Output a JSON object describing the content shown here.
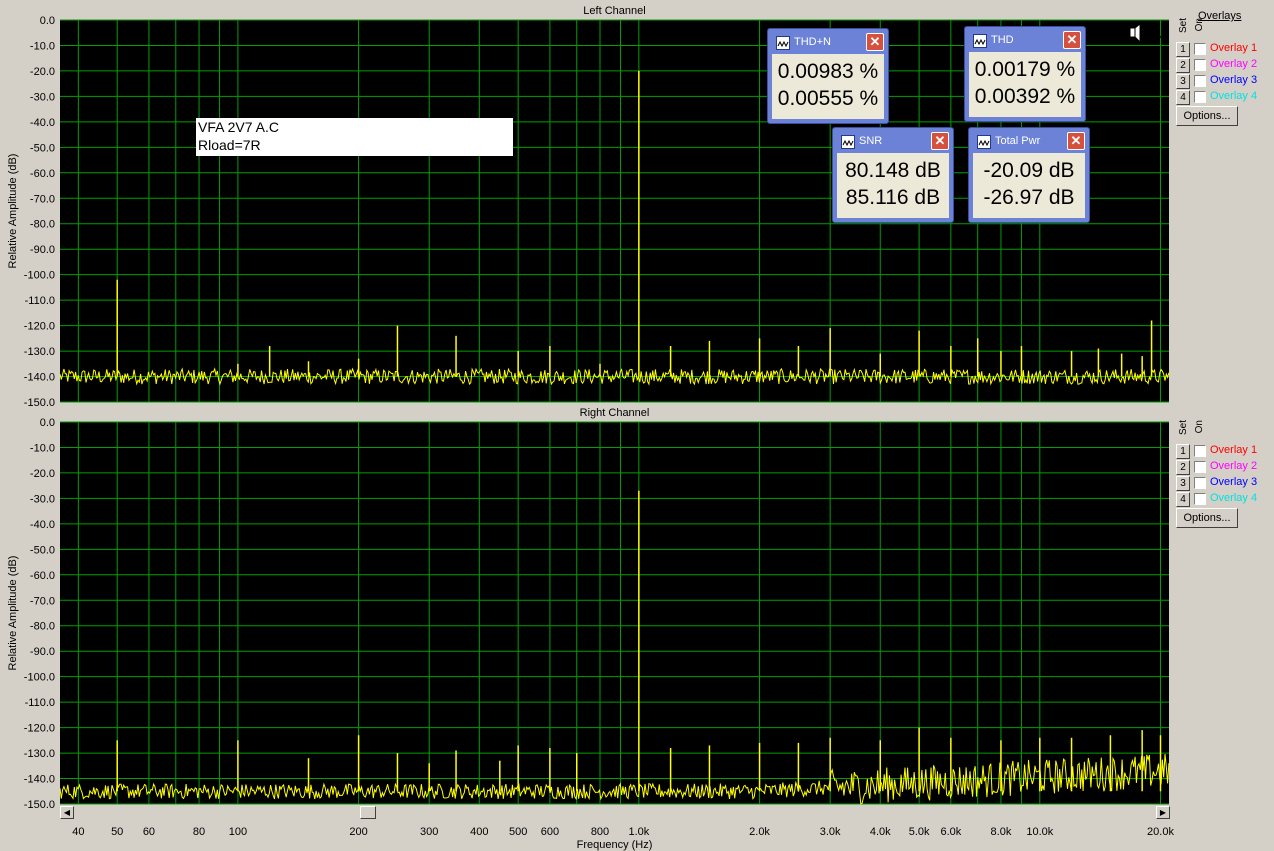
{
  "chart_data": [
    {
      "type": "line",
      "title": "Left Channel",
      "xlabel": "Frequency (Hz)",
      "ylabel": "Relative Amplitude (dB)",
      "xscale": "log",
      "xlim": [
        36,
        21000
      ],
      "ylim": [
        -150,
        0
      ],
      "grid": true,
      "line_color": "#ffff00",
      "background": "#000000",
      "grid_color": "#00a000",
      "noise_floor": -140,
      "yticks": [
        "0.0",
        "-10.0",
        "-20.0",
        "-30.0",
        "-40.0",
        "-50.0",
        "-60.0",
        "-70.0",
        "-80.0",
        "-90.0",
        "-100.0",
        "-110.0",
        "-120.0",
        "-130.0",
        "-140.0",
        "-150.0"
      ],
      "peaks": [
        {
          "x": 50,
          "y": -102
        },
        {
          "x": 100,
          "y": -135
        },
        {
          "x": 120,
          "y": -128
        },
        {
          "x": 150,
          "y": -134
        },
        {
          "x": 200,
          "y": -133
        },
        {
          "x": 250,
          "y": -120
        },
        {
          "x": 350,
          "y": -124
        },
        {
          "x": 500,
          "y": -130
        },
        {
          "x": 600,
          "y": -128
        },
        {
          "x": 800,
          "y": -135
        },
        {
          "x": 1000,
          "y": -20
        },
        {
          "x": 1200,
          "y": -128
        },
        {
          "x": 1500,
          "y": -126
        },
        {
          "x": 2000,
          "y": -125
        },
        {
          "x": 2500,
          "y": -128
        },
        {
          "x": 3000,
          "y": -121
        },
        {
          "x": 4000,
          "y": -131
        },
        {
          "x": 5000,
          "y": -122
        },
        {
          "x": 6000,
          "y": -128
        },
        {
          "x": 7000,
          "y": -125
        },
        {
          "x": 8000,
          "y": -130
        },
        {
          "x": 9000,
          "y": -128
        },
        {
          "x": 12000,
          "y": -130
        },
        {
          "x": 14000,
          "y": -129
        },
        {
          "x": 16000,
          "y": -131
        },
        {
          "x": 18000,
          "y": -132
        },
        {
          "x": 19000,
          "y": -118
        }
      ],
      "annotation": [
        "VFA 2V7 A.C",
        "Rload=7R"
      ]
    },
    {
      "type": "line",
      "title": "Right Channel",
      "xlabel": "Frequency (Hz)",
      "ylabel": "Relative Amplitude (dB)",
      "xscale": "log",
      "xlim": [
        36,
        21000
      ],
      "ylim": [
        -150,
        0
      ],
      "grid": true,
      "line_color": "#ffff00",
      "background": "#000000",
      "grid_color": "#00a000",
      "noise_floor": -145,
      "xticks": [
        {
          "value": 40,
          "label": "40"
        },
        {
          "value": 50,
          "label": "50"
        },
        {
          "value": 60,
          "label": "60"
        },
        {
          "value": 80,
          "label": "80"
        },
        {
          "value": 100,
          "label": "100"
        },
        {
          "value": 200,
          "label": "200"
        },
        {
          "value": 300,
          "label": "300"
        },
        {
          "value": 400,
          "label": "400"
        },
        {
          "value": 500,
          "label": "500"
        },
        {
          "value": 600,
          "label": "600"
        },
        {
          "value": 800,
          "label": "800"
        },
        {
          "value": 1000,
          "label": "1.0k"
        },
        {
          "value": 2000,
          "label": "2.0k"
        },
        {
          "value": 3000,
          "label": "3.0k"
        },
        {
          "value": 4000,
          "label": "4.0k"
        },
        {
          "value": 5000,
          "label": "5.0k"
        },
        {
          "value": 6000,
          "label": "6.0k"
        },
        {
          "value": 8000,
          "label": "8.0k"
        },
        {
          "value": 10000,
          "label": "10.0k"
        },
        {
          "value": 20000,
          "label": "20.0k"
        }
      ],
      "yticks": [
        "0.0",
        "-10.0",
        "-20.0",
        "-30.0",
        "-40.0",
        "-50.0",
        "-60.0",
        "-70.0",
        "-80.0",
        "-90.0",
        "-100.0",
        "-110.0",
        "-120.0",
        "-130.0",
        "-140.0",
        "-150.0"
      ],
      "peaks": [
        {
          "x": 50,
          "y": -125
        },
        {
          "x": 100,
          "y": -125
        },
        {
          "x": 150,
          "y": -132
        },
        {
          "x": 200,
          "y": -123
        },
        {
          "x": 250,
          "y": -130
        },
        {
          "x": 300,
          "y": -134
        },
        {
          "x": 350,
          "y": -129
        },
        {
          "x": 450,
          "y": -133
        },
        {
          "x": 500,
          "y": -127
        },
        {
          "x": 600,
          "y": -128
        },
        {
          "x": 700,
          "y": -130
        },
        {
          "x": 1000,
          "y": -27
        },
        {
          "x": 1200,
          "y": -128
        },
        {
          "x": 1500,
          "y": -127
        },
        {
          "x": 2000,
          "y": -126
        },
        {
          "x": 2500,
          "y": -126
        },
        {
          "x": 3000,
          "y": -124
        },
        {
          "x": 4000,
          "y": -125
        },
        {
          "x": 5000,
          "y": -120
        },
        {
          "x": 6000,
          "y": -124
        },
        {
          "x": 8000,
          "y": -125
        },
        {
          "x": 10000,
          "y": -124
        },
        {
          "x": 12000,
          "y": -124
        },
        {
          "x": 15000,
          "y": -123
        },
        {
          "x": 18000,
          "y": -121
        },
        {
          "x": 20000,
          "y": -123
        }
      ]
    }
  ],
  "overlays": {
    "title": "Overlays",
    "set_label": "Set",
    "on_label": "On",
    "items": [
      {
        "num": "1",
        "label": "Overlay 1",
        "color": "#ff0000"
      },
      {
        "num": "2",
        "label": "Overlay 2",
        "color": "#ff00ff"
      },
      {
        "num": "3",
        "label": "Overlay 3",
        "color": "#0000ff"
      },
      {
        "num": "4",
        "label": "Overlay 4",
        "color": "#00e0e0"
      }
    ],
    "options_label": "Options..."
  },
  "meters": {
    "thdn": {
      "name": "THD+N",
      "v1": "0.00983 %",
      "v2": "0.00555 %"
    },
    "thd": {
      "name": "THD",
      "v1": "0.00179 %",
      "v2": "0.00392 %"
    },
    "snr": {
      "name": "SNR",
      "v1": "80.148 dB",
      "v2": "85.116 dB"
    },
    "pwr": {
      "name": "Total Pwr",
      "v1": "-20.09 dB",
      "v2": "-26.97 dB"
    }
  },
  "icons": {
    "close": "close-icon",
    "meter": "meter-icon",
    "speaker": "speaker-sine-icon"
  }
}
